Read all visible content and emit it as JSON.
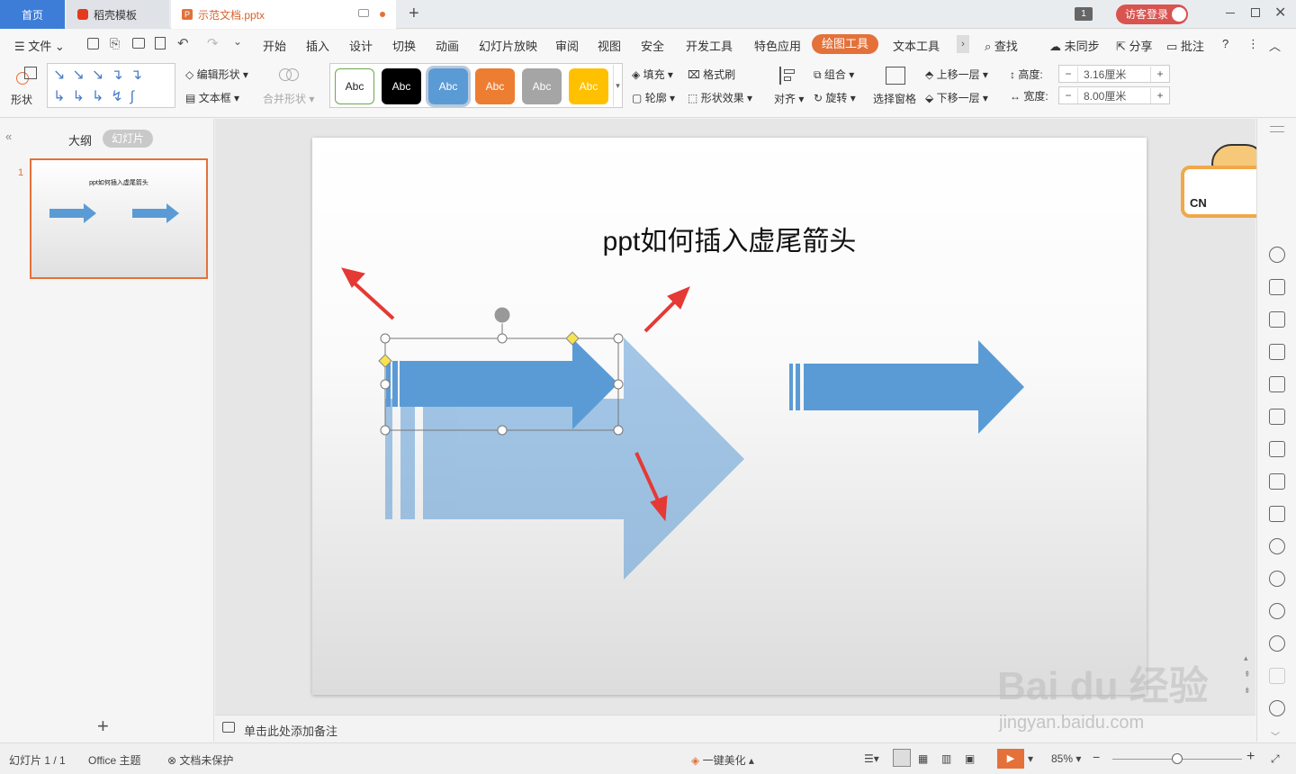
{
  "tabs": {
    "home": "首页",
    "docer": "稻壳模板",
    "doc": "示范文档.pptx",
    "new_tab": "+"
  },
  "title_bar": {
    "window_count": "1",
    "login": "访客登录"
  },
  "menu": {
    "file": "文件",
    "items": [
      "开始",
      "插入",
      "设计",
      "切换",
      "动画",
      "幻灯片放映",
      "审阅",
      "视图",
      "安全",
      "开发工具",
      "特色应用",
      "绘图工具",
      "文本工具"
    ],
    "search": "查找",
    "sync": "未同步",
    "share": "分享",
    "comment": "批注",
    "help": "?"
  },
  "ribbon": {
    "shape": "形状",
    "edit_shape": "编辑形状",
    "text_box": "文本框",
    "merge_shape": "合并形状",
    "style_samples": [
      "Abc",
      "Abc",
      "Abc",
      "Abc",
      "Abc",
      "Abc"
    ],
    "style_colors": [
      "#ffffff",
      "#000000",
      "#5b9bd5",
      "#ed7d31",
      "#a5a5a5",
      "#ffc000"
    ],
    "fill": "填充",
    "format_painter": "格式刷",
    "outline": "轮廓",
    "shape_effect": "形状效果",
    "align": "对齐",
    "group": "组合",
    "rotate": "旋转",
    "selection_pane": "选择窗格",
    "bring_forward": "上移一层",
    "send_backward": "下移一层",
    "height_label": "高度:",
    "height_value": "3.16厘米",
    "width_label": "宽度:",
    "width_value": "8.00厘米"
  },
  "left_panel": {
    "outline_tab": "大纲",
    "slides_tab": "幻灯片",
    "slide_number": "1",
    "thumb_title": "ppt如何插入虚尾箭头",
    "add": "+"
  },
  "slide": {
    "title": "ppt如何插入虚尾箭头"
  },
  "notes": {
    "placeholder": "单击此处添加备注"
  },
  "status": {
    "slide_info": "幻灯片 1 / 1",
    "theme": "Office 主题",
    "protect": "文档未保护",
    "beautify": "一键美化",
    "zoom": "85%",
    "zoom_level": 0.5
  },
  "overlay": {
    "badge": "CN",
    "watermark": "Bai du 经验",
    "watermark_url": "jingyan.baidu.com"
  },
  "colors": {
    "accent": "#e4713a",
    "home_tab": "#3d7dd8",
    "arrow": "#5b9bd5",
    "annotation": "#e53935"
  }
}
